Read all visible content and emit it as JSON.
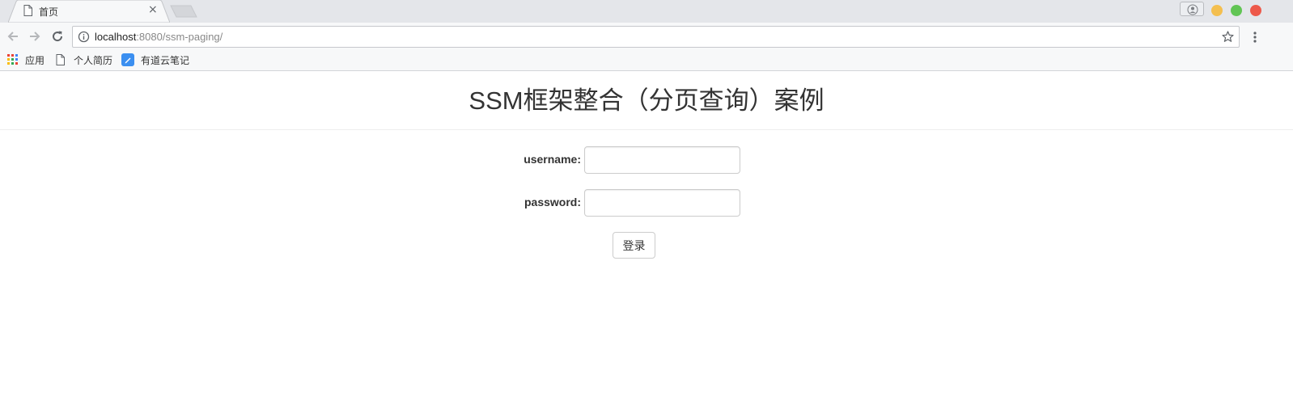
{
  "browser": {
    "tab": {
      "title": "首页",
      "close": "×"
    },
    "address": {
      "host": "localhost",
      "path": ":8080/ssm-paging/"
    },
    "bookmarks": [
      {
        "label": "应用",
        "icon": "apps-grid-icon"
      },
      {
        "label": "个人简历",
        "icon": "document-icon"
      },
      {
        "label": "有道云笔记",
        "icon": "youdao-note-icon"
      }
    ],
    "window_buttons": {
      "minimize_color": "#f4bf4f",
      "maximize_color": "#61c554",
      "close_color": "#ed594a"
    }
  },
  "page": {
    "title": "SSM框架整合（分页查询）案例",
    "form": {
      "username_label": "username:",
      "username_value": "",
      "password_label": "password:",
      "password_value": "",
      "submit_label": "登录"
    }
  }
}
